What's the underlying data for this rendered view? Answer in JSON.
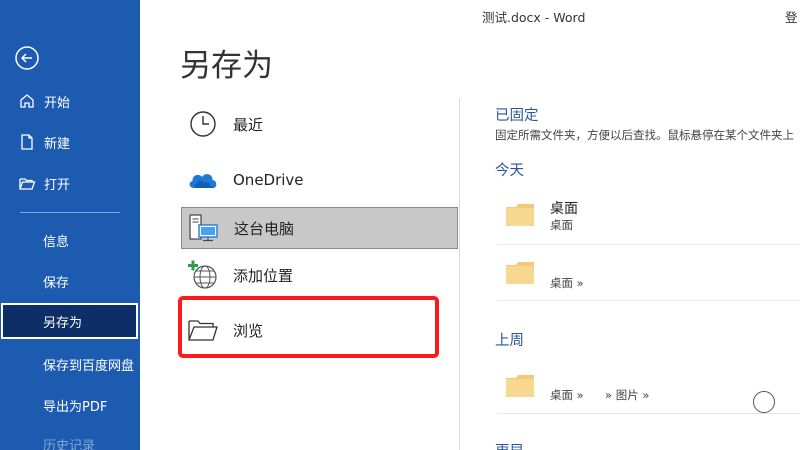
{
  "window": {
    "title": "测试.docx  -  Word",
    "account_label": "登"
  },
  "sidebar": {
    "back_icon": "back-arrow-icon",
    "top_items": [
      {
        "label": "开始",
        "icon": "home-icon"
      },
      {
        "label": "新建",
        "icon": "new-document-icon"
      },
      {
        "label": "打开",
        "icon": "open-folder-icon"
      }
    ],
    "items": [
      {
        "label": "信息"
      },
      {
        "label": "保存"
      },
      {
        "label": "另存为",
        "selected": true
      },
      {
        "label": "保存到百度网盘"
      },
      {
        "label": "导出为PDF"
      },
      {
        "label": "历史记录"
      }
    ]
  },
  "page": {
    "title": "另存为"
  },
  "locations": [
    {
      "label": "最近",
      "icon": "clock-icon"
    },
    {
      "label": "OneDrive",
      "icon": "onedrive-cloud-icon"
    },
    {
      "label": "这台电脑",
      "icon": "this-pc-icon",
      "selected": true
    },
    {
      "label": "添加位置",
      "icon": "add-location-globe-icon"
    },
    {
      "label": "浏览",
      "icon": "browse-folder-icon"
    }
  ],
  "highlight_color": "#ff1a1a",
  "accent_color": "#2b579a",
  "sidebar_color": "#1d5bb0",
  "right_panel": {
    "pinned": {
      "title": "已固定",
      "description": "固定所需文件夹，方便以后查找。鼠标悬停在某个文件夹上"
    },
    "today": {
      "title": "今天",
      "folders": [
        {
          "name": "桌面",
          "path": "桌面"
        },
        {
          "name": "",
          "path": "桌面 »"
        }
      ]
    },
    "last_week": {
      "title": "上周",
      "folders": [
        {
          "name": "",
          "path": "桌面 »",
          "path2": "» 图片 »"
        }
      ]
    },
    "older": {
      "title": "更早"
    }
  }
}
